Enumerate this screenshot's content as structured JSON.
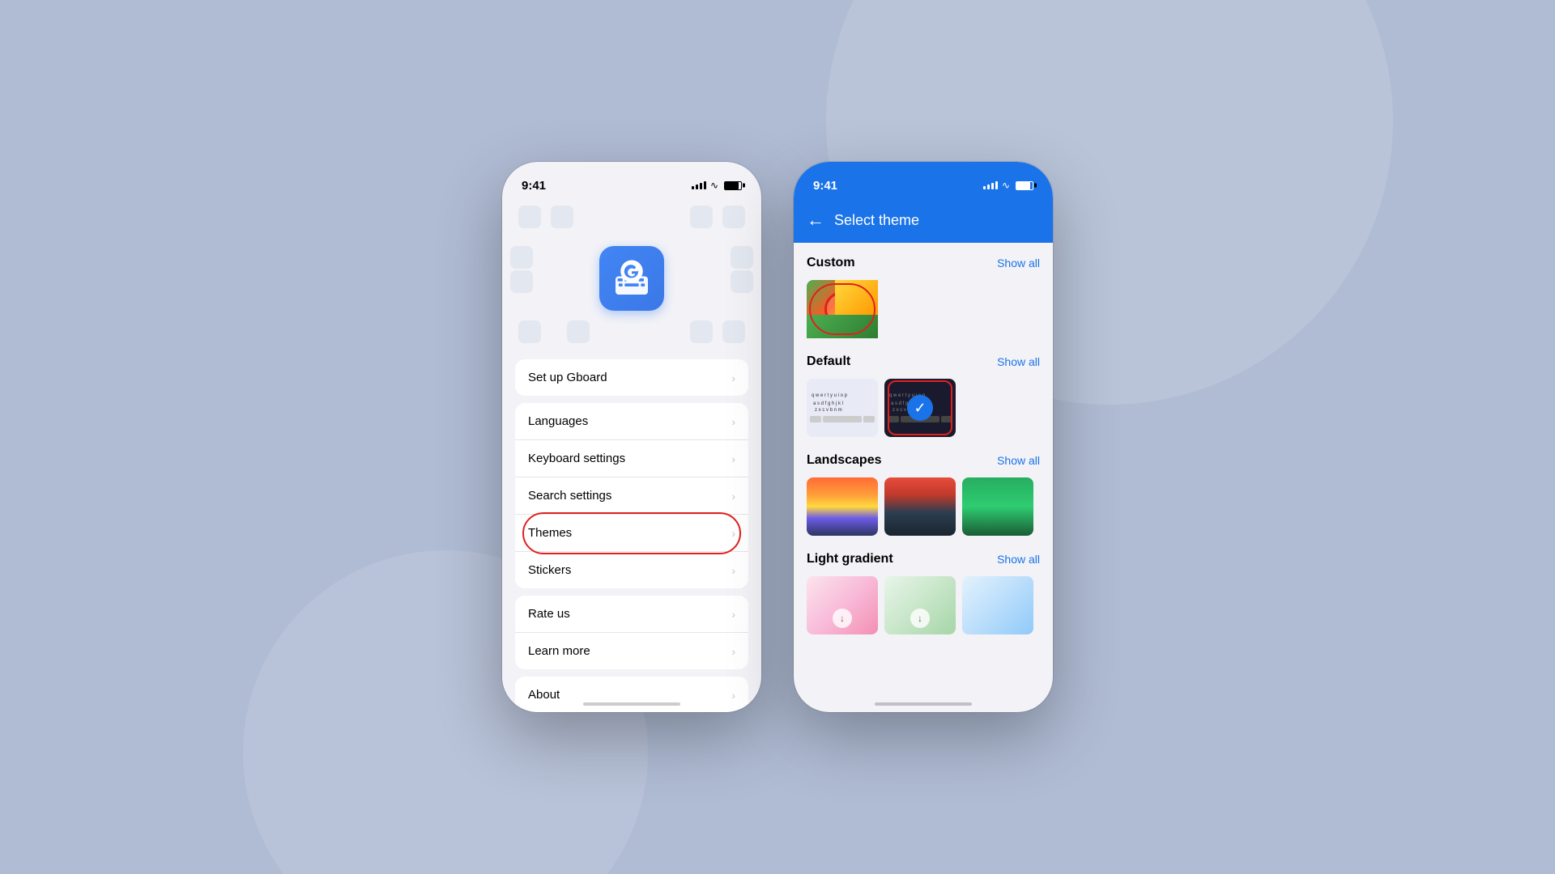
{
  "background": {
    "color": "#b0bcd4"
  },
  "phone1": {
    "status": {
      "time": "9:41"
    },
    "menu_items": [
      {
        "id": "setup",
        "label": "Set up Gboard"
      },
      {
        "id": "languages",
        "label": "Languages"
      },
      {
        "id": "keyboard_settings",
        "label": "Keyboard settings"
      },
      {
        "id": "search_settings",
        "label": "Search settings"
      },
      {
        "id": "themes",
        "label": "Themes"
      },
      {
        "id": "stickers",
        "label": "Stickers"
      },
      {
        "id": "rate_us",
        "label": "Rate us"
      },
      {
        "id": "learn_more",
        "label": "Learn more"
      },
      {
        "id": "about",
        "label": "About"
      }
    ]
  },
  "phone2": {
    "status": {
      "time": "9:41"
    },
    "header": {
      "back_label": "←",
      "title": "Select theme"
    },
    "sections": [
      {
        "id": "custom",
        "title": "Custom",
        "show_all": "Show all"
      },
      {
        "id": "default",
        "title": "Default",
        "show_all": "Show all"
      },
      {
        "id": "landscapes",
        "title": "Landscapes",
        "show_all": "Show all"
      },
      {
        "id": "light_gradient",
        "title": "Light gradient",
        "show_all": "Show all"
      }
    ]
  }
}
